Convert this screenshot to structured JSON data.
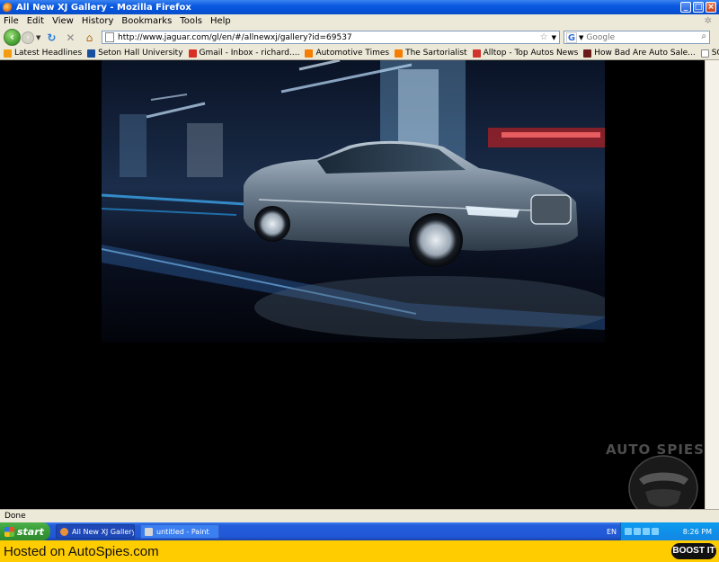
{
  "window": {
    "title": "All New XJ Gallery - Mozilla Firefox",
    "min_glyph": "_",
    "max_glyph": "□",
    "close_glyph": "×"
  },
  "menu": [
    "File",
    "Edit",
    "View",
    "History",
    "Bookmarks",
    "Tools",
    "Help"
  ],
  "navbar": {
    "back_glyph": "‹",
    "forward_glyph": "›",
    "reload_glyph": "↻",
    "stop_glyph": "✕",
    "home_glyph": "⌂",
    "url": "http://www.jaguar.com/gl/en/#/allnewxj/gallery?id=69537",
    "search_placeholder": "Google",
    "search_engine_glyph": "G"
  },
  "bookmarks": [
    {
      "label": "Latest Headlines",
      "icon": "rss-icon",
      "color": "#f39c12"
    },
    {
      "label": "Seton Hall University",
      "icon": "crest-icon",
      "color": "#1a4fa0"
    },
    {
      "label": "Gmail - Inbox - richard....",
      "icon": "gmail-icon",
      "color": "#d93025"
    },
    {
      "label": "Automotive Times",
      "icon": "blogger-icon",
      "color": "#f57d00"
    },
    {
      "label": "The Sartorialist",
      "icon": "blogger-icon",
      "color": "#f57d00"
    },
    {
      "label": "Alltop - Top Autos News",
      "icon": "alltop-icon",
      "color": "#d0342c"
    },
    {
      "label": "How Bad Are Auto Sale...",
      "icon": "site-icon",
      "color": "#6b1a1a"
    },
    {
      "label": "SCOUTING NY - www.s...",
      "icon": "page-icon",
      "color": "#ffffff"
    }
  ],
  "status": "Done",
  "taskbar": {
    "start_label": "start",
    "tasks": [
      {
        "label": "All New XJ Gallery - M...",
        "active": true
      },
      {
        "label": "untitled - Paint",
        "active": false
      }
    ],
    "language": "EN",
    "clock": "8:26 PM"
  },
  "watermark": "AUTO SPIES",
  "footer": {
    "hosted": "Hosted on AutoSpies.com",
    "boost": "BOOST IT"
  },
  "colors": {
    "titlebar": "#0a5ae0",
    "chrome": "#ece9d8",
    "footer": "#ffcc00",
    "taskbar": "#245edb"
  }
}
